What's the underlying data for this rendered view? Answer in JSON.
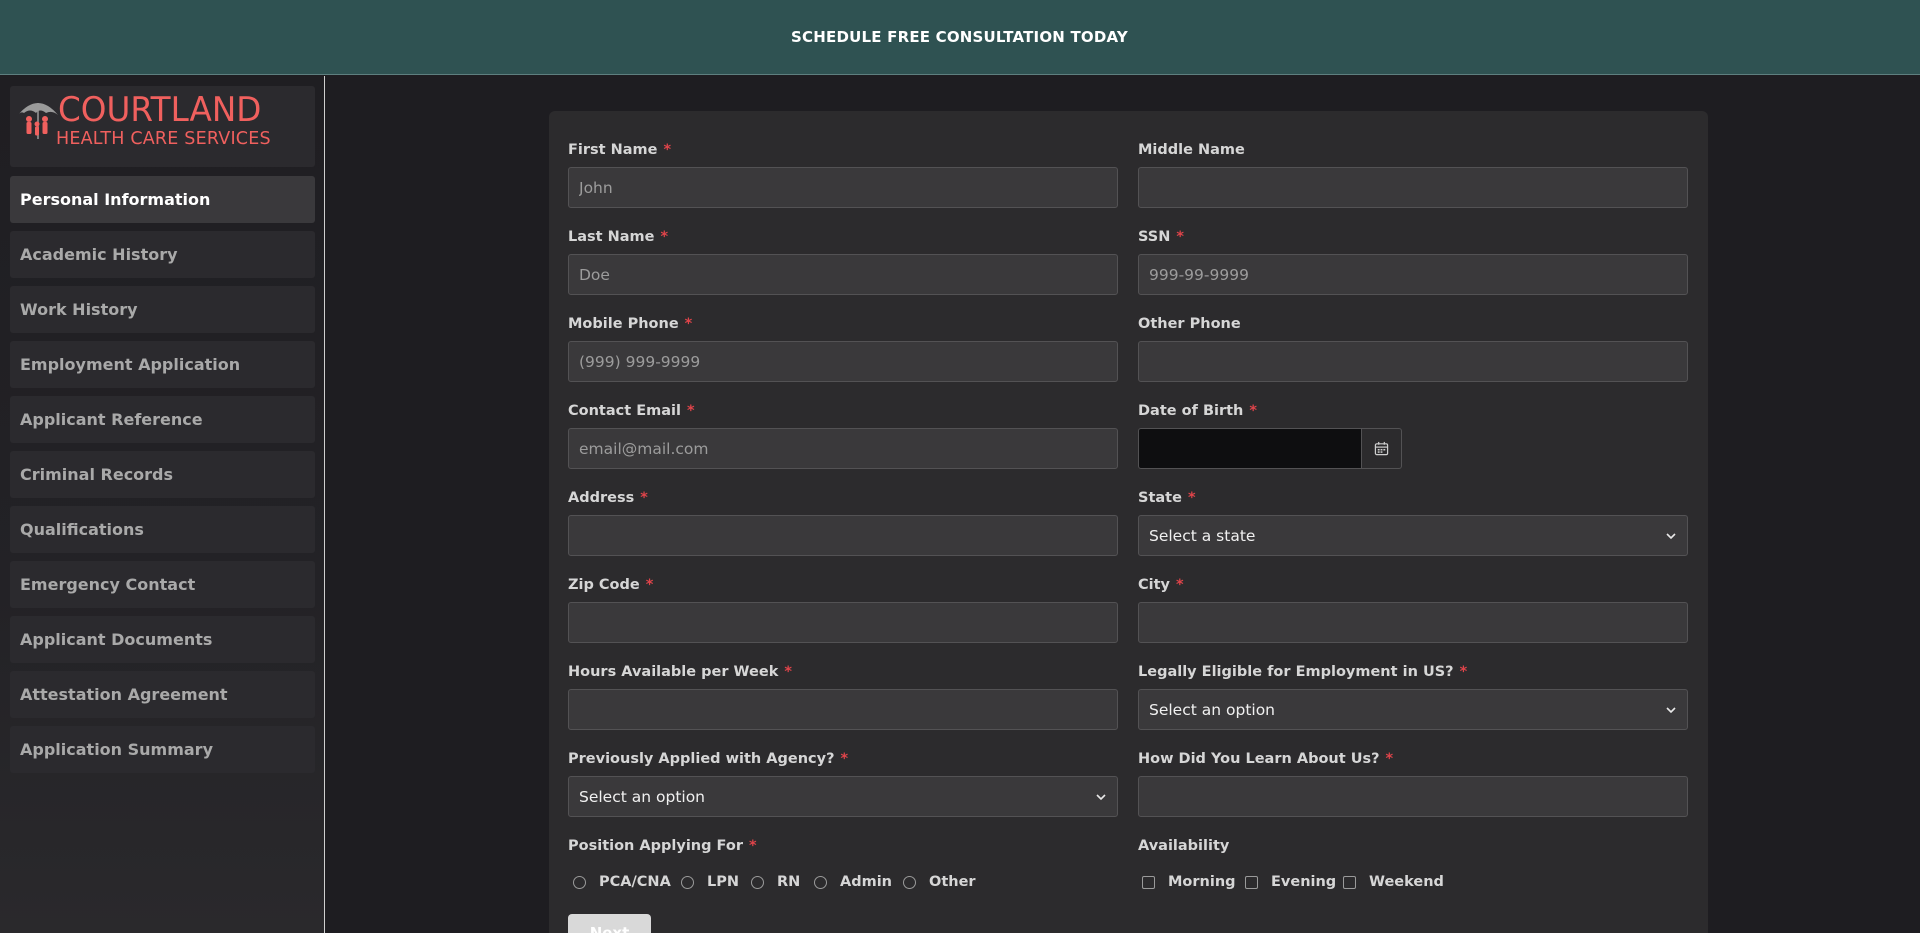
{
  "banner": {
    "text": "SCHEDULE FREE CONSULTATION TODAY"
  },
  "logo": {
    "title": "COURTLAND",
    "subtitle": "HEALTH CARE SERVICES"
  },
  "sidebar": {
    "items": [
      {
        "label": "Personal Information",
        "active": true
      },
      {
        "label": "Academic History"
      },
      {
        "label": "Work History"
      },
      {
        "label": "Employment Application"
      },
      {
        "label": "Applicant Reference"
      },
      {
        "label": "Criminal Records"
      },
      {
        "label": "Qualifications"
      },
      {
        "label": "Emergency Contact"
      },
      {
        "label": "Applicant Documents"
      },
      {
        "label": "Attestation Agreement"
      },
      {
        "label": "Application Summary"
      }
    ]
  },
  "form": {
    "first_name": {
      "label": "First Name",
      "required": "*",
      "placeholder": "John",
      "value": ""
    },
    "middle_name": {
      "label": "Middle Name",
      "placeholder": "",
      "value": ""
    },
    "last_name": {
      "label": "Last Name",
      "required": "*",
      "placeholder": "Doe",
      "value": ""
    },
    "ssn": {
      "label": "SSN",
      "required": "*",
      "placeholder": "999-99-9999",
      "value": ""
    },
    "mobile_phone": {
      "label": "Mobile Phone",
      "required": "*",
      "placeholder": "(999) 999-9999",
      "value": ""
    },
    "other_phone": {
      "label": "Other Phone",
      "placeholder": "",
      "value": ""
    },
    "contact_email": {
      "label": "Contact Email",
      "required": "*",
      "placeholder": "email@mail.com",
      "value": ""
    },
    "date_of_birth": {
      "label": "Date of Birth",
      "required": "*",
      "value": ""
    },
    "address": {
      "label": "Address",
      "required": "*",
      "placeholder": "",
      "value": ""
    },
    "state": {
      "label": "State",
      "required": "*",
      "selected": "Select a state"
    },
    "zip_code": {
      "label": "Zip Code",
      "required": "*",
      "placeholder": "",
      "value": ""
    },
    "city": {
      "label": "City",
      "required": "*",
      "placeholder": "",
      "value": ""
    },
    "hours": {
      "label": "Hours Available per Week",
      "required": "*",
      "placeholder": "",
      "value": ""
    },
    "eligible": {
      "label": "Legally Eligible for Employment in US?",
      "required": "*",
      "selected": "Select an option"
    },
    "previously_applied": {
      "label": "Previously Applied with Agency?",
      "required": "*",
      "selected": "Select an option"
    },
    "learn_about": {
      "label": "How Did You Learn About Us?",
      "required": "*",
      "placeholder": "",
      "value": ""
    },
    "position": {
      "label": "Position Applying For",
      "required": "*",
      "options": [
        "PCA/CNA",
        "LPN",
        "RN",
        "Admin",
        "Other"
      ]
    },
    "availability": {
      "label": "Availability",
      "options": [
        "Morning",
        "Evening",
        "Weekend"
      ]
    },
    "next_label": "Next"
  },
  "colors": {
    "banner_bg": "#2f5252",
    "page_bg": "#1e1d21",
    "card_bg": "#2c2b2d",
    "required_star": "#e0444a",
    "logo_red": "#f0605e"
  },
  "icons": [
    "umbrella-family-logo-icon",
    "calendar-icon",
    "chevron-down-icon"
  ]
}
